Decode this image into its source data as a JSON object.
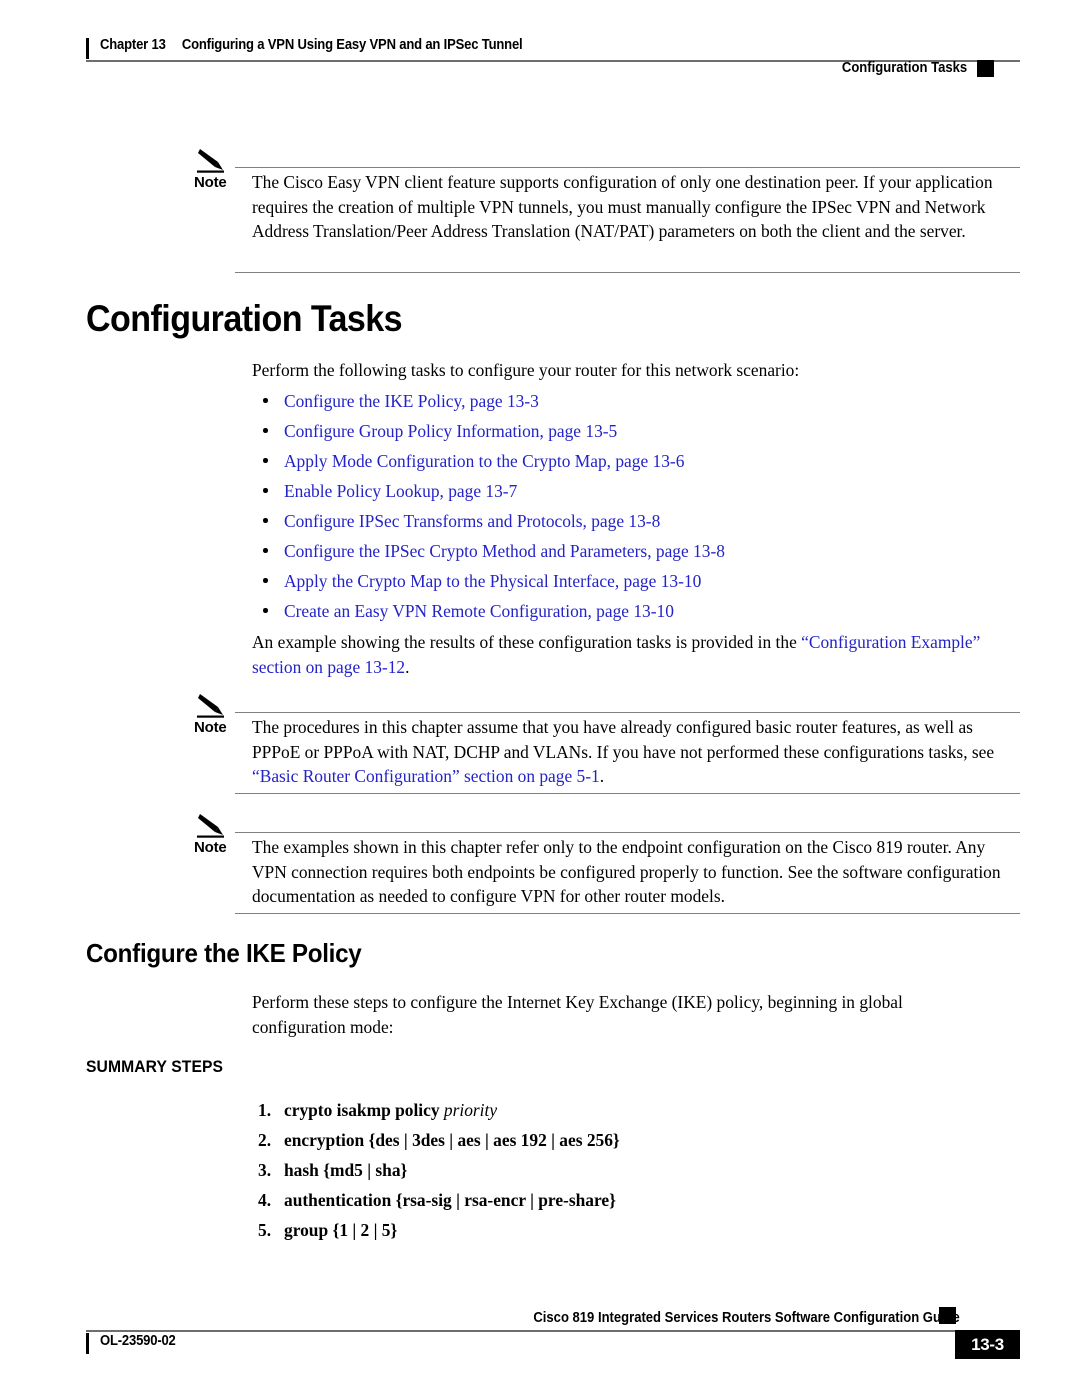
{
  "header": {
    "chapter_number": "Chapter 13",
    "chapter_title": "Configuring a VPN Using Easy VPN and an IPSec Tunnel",
    "section_right": "Configuration Tasks"
  },
  "notes": [
    {
      "label": "Note",
      "text": "The Cisco Easy VPN client feature supports configuration of only one destination peer. If your application requires the creation of multiple VPN tunnels, you must manually configure the IPSec VPN and Network Address Translation/Peer Address Translation (NAT/PAT) parameters on both the client and the server."
    },
    {
      "label": "Note",
      "text_before_link": "The procedures in this chapter assume that you have already configured basic router features, as well as PPPoE or PPPoA with NAT, DCHP and VLANs. If you have not performed these configurations tasks, see ",
      "link": "“Basic Router Configuration” section on page 5-1",
      "text_after_link": "."
    },
    {
      "label": "Note",
      "text": "The examples shown in this chapter refer only to the endpoint configuration on the Cisco 819 router. Any VPN connection requires both endpoints be configured properly to function. See the software configuration documentation as needed to configure VPN for other router models."
    }
  ],
  "section1": {
    "heading": "Configuration Tasks",
    "intro": "Perform the following tasks to configure your router for this network scenario:",
    "bullets": [
      "Configure the IKE Policy, page 13-3",
      "Configure Group Policy Information, page 13-5",
      "Apply Mode Configuration to the Crypto Map, page 13-6",
      "Enable Policy Lookup, page 13-7",
      "Configure IPSec Transforms and Protocols, page 13-8",
      "Configure the IPSec Crypto Method and Parameters, page 13-8",
      "Apply the Crypto Map to the Physical Interface, page 13-10",
      "Create an Easy VPN Remote Configuration, page 13-10"
    ],
    "example_para_before": "An example showing the results of these configuration tasks is provided in the ",
    "example_para_link": "“Configuration Example” section on page 13-12",
    "example_para_after": "."
  },
  "section2": {
    "heading": "Configure the IKE Policy",
    "intro": "Perform these steps to configure the Internet Key Exchange (IKE) policy, beginning in global configuration mode:",
    "summary_label": "SUMMARY STEPS",
    "steps": [
      {
        "num": "1.",
        "command": "crypto isakmp policy ",
        "variable": "priority",
        "tail": ""
      },
      {
        "num": "2.",
        "command": "encryption {des | 3des | aes | aes 192 | aes 256}",
        "variable": "",
        "tail": ""
      },
      {
        "num": "3.",
        "command": "hash {md5 | sha}",
        "variable": "",
        "tail": ""
      },
      {
        "num": "4.",
        "command": "authentication {rsa-sig | rsa-encr | pre-share}",
        "variable": "",
        "tail": ""
      },
      {
        "num": "5.",
        "command": "group {1 | 2 | 5}",
        "variable": "",
        "tail": ""
      }
    ]
  },
  "footer": {
    "guide_title": "Cisco 819 Integrated Services Routers Software Configuration Guide",
    "doc_id": "OL-23590-02",
    "page_number": "13-3"
  },
  "colors": {
    "link": "#2323c8",
    "rule": "#808080",
    "text": "#000000"
  }
}
